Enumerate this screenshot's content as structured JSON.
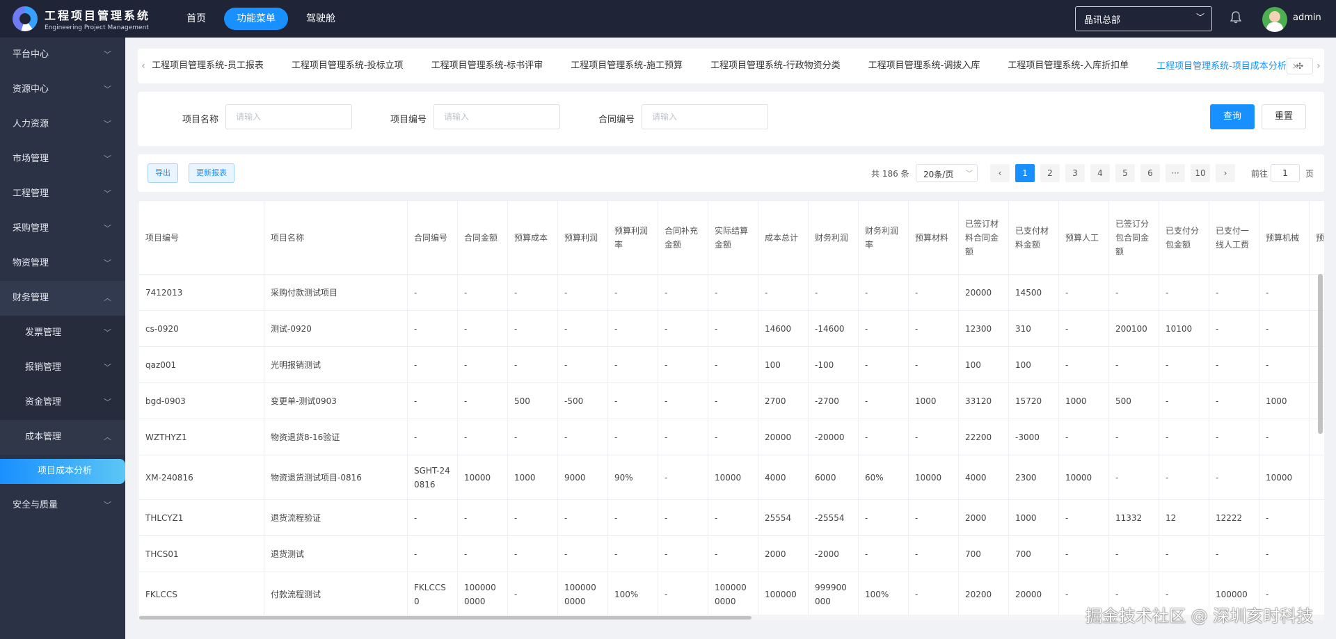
{
  "app": {
    "title": "工程项目管理系统",
    "subtitle": "Engineering Project Management"
  },
  "topnav": {
    "items": [
      "首页",
      "功能菜单",
      "驾驶舱"
    ],
    "active_index": 1
  },
  "org_select": {
    "value": "晶讯总部"
  },
  "user": {
    "name": "admin"
  },
  "sidebar": {
    "items": [
      {
        "label": "平台中心",
        "open": false
      },
      {
        "label": "资源中心",
        "open": false
      },
      {
        "label": "人力资源",
        "open": false
      },
      {
        "label": "市场管理",
        "open": false
      },
      {
        "label": "工程管理",
        "open": false
      },
      {
        "label": "采购管理",
        "open": false
      },
      {
        "label": "物资管理",
        "open": false
      },
      {
        "label": "财务管理",
        "open": true
      }
    ],
    "finance_sub": [
      "发票管理",
      "报销管理",
      "资金管理",
      "成本管理"
    ],
    "cost_leaf": "项目成本分析",
    "last_item": "安全与质量"
  },
  "tabs": {
    "items": [
      "工程项目管理系统-员工报表",
      "工程项目管理系统-投标立项",
      "工程项目管理系统-标书评审",
      "工程项目管理系统-施工预算",
      "工程项目管理系统-行政物资分类",
      "工程项目管理系统-调拨入库",
      "工程项目管理系统-入库折扣单",
      "工程项目管理系统-项目成本分析"
    ],
    "active_index": 7,
    "close": "×"
  },
  "search": {
    "fields": [
      {
        "label": "项目名称",
        "placeholder": "请输入"
      },
      {
        "label": "项目编号",
        "placeholder": "请输入"
      },
      {
        "label": "合同编号",
        "placeholder": "请输入"
      }
    ],
    "query_label": "查询",
    "reset_label": "重置"
  },
  "toolbar": {
    "export_label": "导出",
    "refresh_label": "更新报表"
  },
  "pagination": {
    "total": "共 186 条",
    "page_size": "20条/页",
    "pages": [
      "1",
      "2",
      "3",
      "4",
      "5",
      "6",
      "···",
      "10"
    ],
    "current": "1",
    "goto_label": "前往",
    "goto_value": "1",
    "unit": "页"
  },
  "table": {
    "headers": [
      "项目编号",
      "项目名称",
      "合同编号",
      "合同金额",
      "预算成本",
      "预算利润",
      "预算利润率",
      "合同补充金额",
      "实际结算金额",
      "成本总计",
      "财务利润",
      "财务利润率",
      "预算材料",
      "已签订材料合同金额",
      "已支付材料金额",
      "预算人工",
      "已签订分包合同金额",
      "已支付分包金额",
      "已支付一线人工费",
      "预算机械",
      "预"
    ],
    "rows": [
      [
        "7412013",
        "采购付款测试项目",
        "-",
        "-",
        "-",
        "-",
        "-",
        "-",
        "-",
        "-",
        "-",
        "-",
        "-",
        "20000",
        "14500",
        "-",
        "-",
        "-",
        "-",
        "-",
        ""
      ],
      [
        "cs-0920",
        "测试-0920",
        "-",
        "-",
        "-",
        "-",
        "-",
        "-",
        "-",
        "14600",
        "-14600",
        "-",
        "-",
        "12300",
        "310",
        "-",
        "200100",
        "10100",
        "-",
        "-",
        ""
      ],
      [
        "qaz001",
        "光明报销测试",
        "-",
        "-",
        "-",
        "-",
        "-",
        "-",
        "-",
        "100",
        "-100",
        "-",
        "-",
        "100",
        "100",
        "-",
        "-",
        "-",
        "-",
        "-",
        ""
      ],
      [
        "bgd-0903",
        "变更单-测试0903",
        "-",
        "-",
        "500",
        "-500",
        "-",
        "-",
        "-",
        "2700",
        "-2700",
        "-",
        "1000",
        "33120",
        "15720",
        "1000",
        "500",
        "-",
        "-",
        "1000",
        ""
      ],
      [
        "WZTHYZ1",
        "物资退货8-16验证",
        "-",
        "-",
        "-",
        "-",
        "-",
        "-",
        "-",
        "20000",
        "-20000",
        "-",
        "-",
        "22200",
        "-3000",
        "-",
        "-",
        "-",
        "-",
        "-",
        ""
      ],
      [
        "XM-240816",
        "物资退货测试项目-0816",
        "SGHT-240816",
        "10000",
        "1000",
        "9000",
        "90%",
        "-",
        "10000",
        "4000",
        "6000",
        "60%",
        "10000",
        "4000",
        "2300",
        "10000",
        "-",
        "-",
        "-",
        "10000",
        ""
      ],
      [
        "THLCYZ1",
        "退货流程验证",
        "-",
        "-",
        "-",
        "-",
        "-",
        "-",
        "-",
        "25554",
        "-25554",
        "-",
        "-",
        "2000",
        "1000",
        "-",
        "11332",
        "12",
        "12222",
        "-",
        ""
      ],
      [
        "THCS01",
        "退货测试",
        "-",
        "-",
        "-",
        "-",
        "-",
        "-",
        "-",
        "2000",
        "-2000",
        "-",
        "-",
        "700",
        "700",
        "-",
        "-",
        "-",
        "-",
        "-",
        ""
      ],
      [
        "FKLCCS",
        "付款流程测试",
        "FKLCCS0",
        "1000000000",
        "-",
        "1000000000",
        "100%",
        "-",
        "1000000000",
        "100000",
        "999900000",
        "100%",
        "-",
        "20200",
        "20000",
        "-",
        "-",
        "-",
        "100000",
        "-",
        ""
      ]
    ]
  },
  "watermark": "掘金技术社区 @ 深圳亥时科技",
  "colors": {
    "topbar": "#1f2536",
    "sidebar": "#2b3245",
    "accent": "#1890ff"
  }
}
